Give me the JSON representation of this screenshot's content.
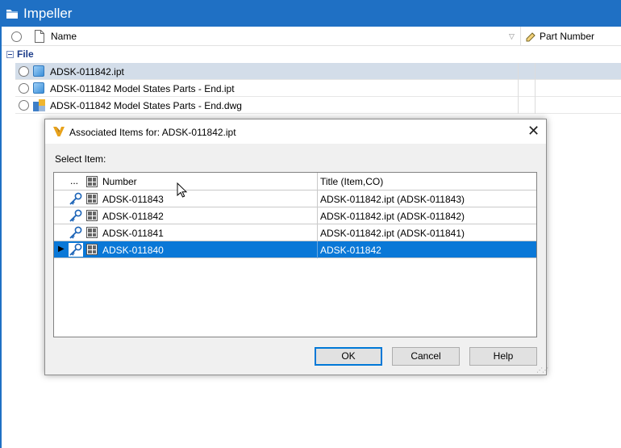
{
  "window": {
    "title": "Impeller",
    "accent": "#1f70c4"
  },
  "columns": {
    "name": "Name",
    "part_number": "Part Number"
  },
  "group": {
    "label": "File"
  },
  "files": [
    {
      "name": "ADSK-011842.ipt",
      "icon": "part-cube-icon",
      "selected": true
    },
    {
      "name": "ADSK-011842 Model States Parts - End.ipt",
      "icon": "part-cube-icon",
      "selected": false
    },
    {
      "name": "ADSK-011842 Model States Parts - End.dwg",
      "icon": "drawing-icon",
      "selected": false
    }
  ],
  "dialog": {
    "title": "Associated Items for: ADSK-011842.ipt",
    "close_glyph": "✕",
    "select_label": "Select Item:",
    "grid": {
      "header": {
        "dots": "...",
        "number": "Number",
        "title": "Title (Item,CO)"
      },
      "rows": [
        {
          "number": "ADSK-011843",
          "title": "ADSK-011842.ipt (ADSK-011843)",
          "selected": false
        },
        {
          "number": "ADSK-011842",
          "title": "ADSK-011842.ipt (ADSK-011842)",
          "selected": false
        },
        {
          "number": "ADSK-011841",
          "title": "ADSK-011842.ipt (ADSK-011841)",
          "selected": false
        },
        {
          "number": "ADSK-011840",
          "title": "ADSK-011842",
          "selected": true
        }
      ],
      "selection_color": "#0a78d7"
    },
    "buttons": {
      "ok": "OK",
      "cancel": "Cancel",
      "help": "Help"
    }
  }
}
